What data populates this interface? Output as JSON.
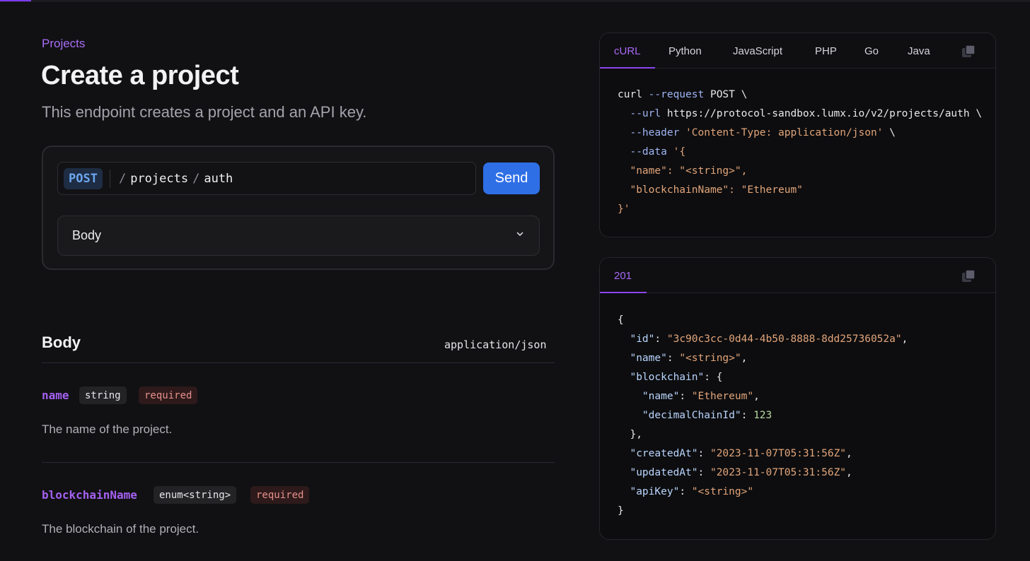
{
  "breadcrumb": "Projects",
  "title": "Create a project",
  "description": "This endpoint creates a project and an API key.",
  "request": {
    "method": "POST",
    "path_segments": [
      "projects",
      "auth"
    ],
    "send_label": "Send",
    "body_label": "Body"
  },
  "body": {
    "heading": "Body",
    "content_type": "application/json",
    "params": [
      {
        "name": "name",
        "type": "string",
        "required": "required",
        "description": "The name of the project."
      },
      {
        "name": "blockchainName",
        "type": "enum<string>",
        "required": "required",
        "description": "The blockchain of the project."
      }
    ]
  },
  "code_samples": {
    "tabs": [
      "cURL",
      "Python",
      "JavaScript",
      "PHP",
      "Go",
      "Java"
    ],
    "active_tab": "cURL",
    "copy_icon": "copy-icon",
    "curl": {
      "line1_cmd": "curl",
      "line1_flag": "--request",
      "line1_method": "POST",
      "line1_end": "\\",
      "line2_flag": "--url",
      "line2_url": "https://protocol-sandbox.lumx.io/v2/projects/auth",
      "line2_end": "\\",
      "line3_flag": "--header",
      "line3_value": "'Content-Type: application/json'",
      "line3_end": "\\",
      "line4_flag": "--data",
      "line4_value": "'{",
      "line5": "\"name\": \"<string>\",",
      "line6": "\"blockchainName\": \"Ethereum\"",
      "line7": "}'"
    }
  },
  "response": {
    "status_tab": "201",
    "copy_icon": "copy-icon",
    "lines": {
      "open": "{",
      "id_key": "\"id\"",
      "id_val": "\"3c90c3cc-0d44-4b50-8888-8dd25736052a\"",
      "name_key": "\"name\"",
      "name_val": "\"<string>\"",
      "blockchain_key": "\"blockchain\"",
      "bc_name_key": "\"name\"",
      "bc_name_val": "\"Ethereum\"",
      "bc_chain_key": "\"decimalChainId\"",
      "bc_chain_val": "123",
      "bc_close": "},",
      "created_key": "\"createdAt\"",
      "created_val": "\"2023-11-07T05:31:56Z\"",
      "updated_key": "\"updatedAt\"",
      "updated_val": "\"2023-11-07T05:31:56Z\"",
      "apikey_key": "\"apiKey\"",
      "apikey_val": "\"<string>\"",
      "close": "}"
    }
  }
}
